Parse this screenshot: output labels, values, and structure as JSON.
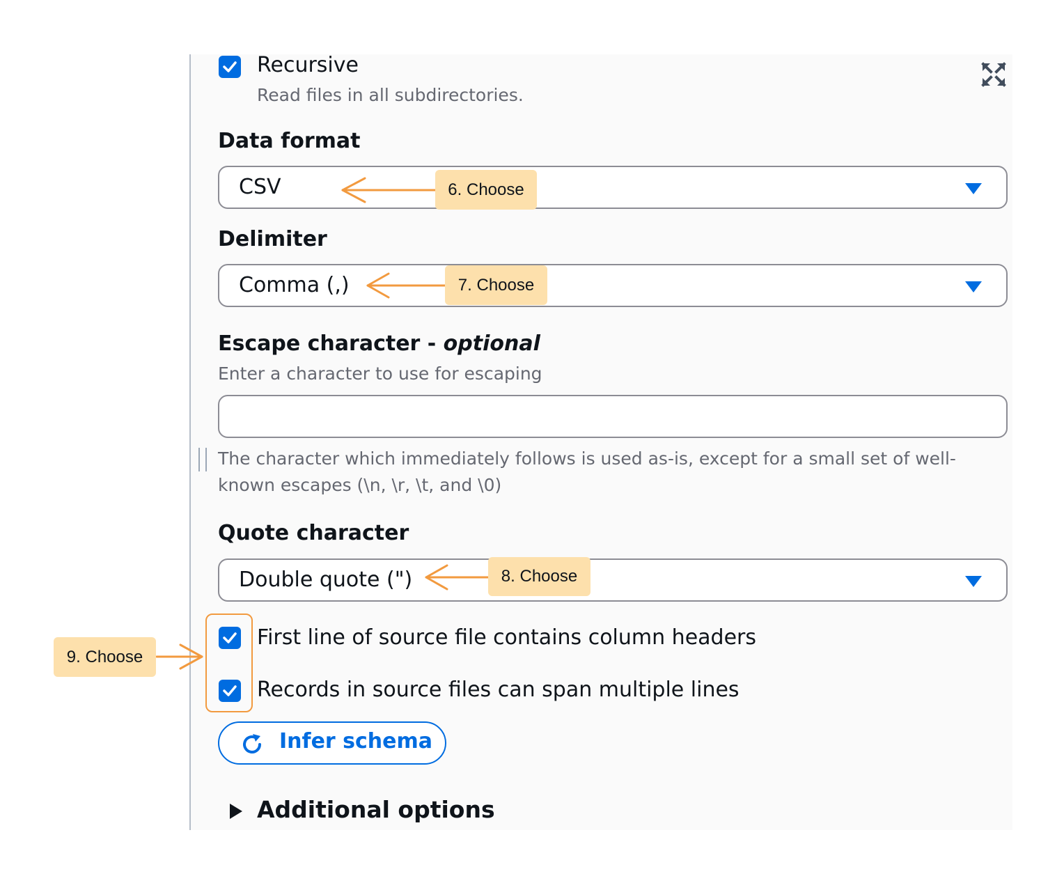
{
  "recursive": {
    "label": "Recursive",
    "description": "Read files in all subdirectories.",
    "checked": true
  },
  "data_format": {
    "label": "Data format",
    "value": "CSV"
  },
  "delimiter": {
    "label": "Delimiter",
    "value": "Comma (,)"
  },
  "escape": {
    "label": "Escape character - ",
    "label_optional": "optional",
    "description": "Enter a character to use for escaping",
    "value": "",
    "help_line1": "The character which immediately follows is used as-is, except for a small set of well-",
    "help_line2": "known escapes (\\n, \\r, \\t, and \\0)"
  },
  "quote": {
    "label": "Quote character",
    "value": "Double quote (\")"
  },
  "first_line_headers": {
    "label": "First line of source file contains column headers",
    "checked": true
  },
  "multiline": {
    "label": "Records in source files can span multiple lines",
    "checked": true
  },
  "infer_schema": {
    "label": "Infer schema"
  },
  "additional_options": {
    "label": "Additional options"
  },
  "callouts": {
    "c6": "6. Choose",
    "c7": "7. Choose",
    "c8": "8. Choose",
    "c9": "9. Choose"
  },
  "colors": {
    "primary": "#006ce0",
    "callout_bg": "#fde0ac",
    "callout_border": "#f29a3f"
  },
  "icons": [
    "checkmark-icon",
    "expand-icon",
    "caret-down-icon",
    "refresh-icon",
    "triangle-right-icon",
    "arrow-left-icon",
    "arrow-right-icon"
  ]
}
